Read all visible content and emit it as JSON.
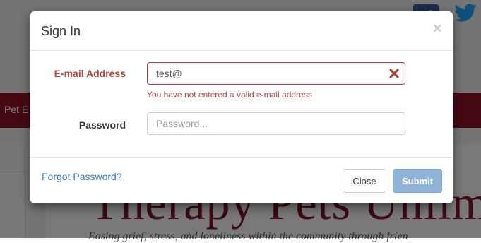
{
  "background": {
    "nav_partial_label": "Pet E",
    "hero_title": "Therapy Pets Unlim",
    "hero_subtitle": "Easing grief, stress, and loneliness within the community through frien",
    "social": [
      "facebook-icon",
      "twitter-icon"
    ],
    "brand_color": "#8a1228"
  },
  "modal": {
    "title": "Sign In",
    "close_glyph": "×",
    "email": {
      "label": "E-mail Address",
      "value": "test@",
      "error": "You have not entered a valid e-mail address",
      "error_color": "#a94442"
    },
    "password": {
      "label": "Password",
      "placeholder": "Password..."
    },
    "forgot_link": "Forgot Password?",
    "buttons": {
      "close": "Close",
      "submit": "Submit"
    }
  }
}
